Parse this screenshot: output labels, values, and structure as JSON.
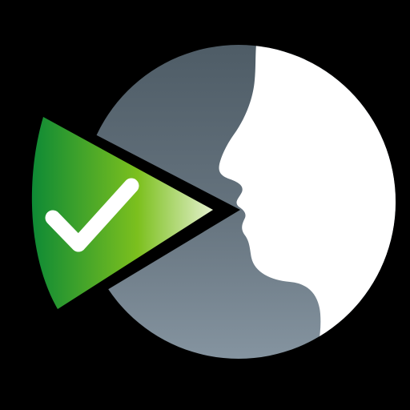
{
  "icon": {
    "kind": "app-icon",
    "depicts": [
      "face-profile-icon",
      "checkmark-icon",
      "speech-cone-icon"
    ],
    "colors": {
      "background": "#000000",
      "disc_dark": "#4e5c66",
      "disc_mid": "#66747f",
      "disc_light": "#8594a0",
      "face": "#ffffff",
      "cone_outline": "#000000",
      "cone_dark_green": "#0e8a35",
      "cone_mid_green": "#7cc01e",
      "cone_light": "#f4f8e8",
      "check": "#ffffff"
    }
  }
}
